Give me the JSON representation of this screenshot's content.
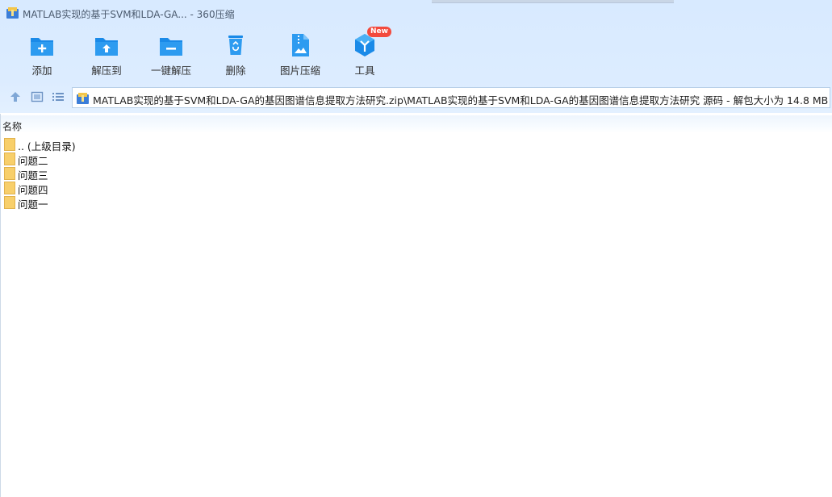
{
  "window": {
    "title": "MATLAB实现的基于SVM和LDA-GA... - 360压缩"
  },
  "toolbar": {
    "items": [
      {
        "label": "添加",
        "icon": "folder-add-icon"
      },
      {
        "label": "解压到",
        "icon": "folder-extract-icon"
      },
      {
        "label": "一键解压",
        "icon": "folder-oneclick-icon"
      },
      {
        "label": "删除",
        "icon": "trash-icon"
      },
      {
        "label": "图片压缩",
        "icon": "image-compress-icon"
      },
      {
        "label": "工具",
        "icon": "tools-icon",
        "badge": "New"
      }
    ]
  },
  "nav": {
    "path": "MATLAB实现的基于SVM和LDA-GA的基因图谱信息提取方法研究.zip\\MATLAB实现的基于SVM和LDA-GA的基因图谱信息提取方法研究 源码 - 解包大小为 14.8 MB"
  },
  "list": {
    "column_name": "名称",
    "rows": [
      {
        "name": ".. (上级目录)"
      },
      {
        "name": "问题二"
      },
      {
        "name": "问题三"
      },
      {
        "name": "问题四"
      },
      {
        "name": "问题一"
      }
    ]
  },
  "colors": {
    "accent": "#1a8ae8",
    "folder": "#f8cf6a",
    "badge": "#f34a3d"
  }
}
